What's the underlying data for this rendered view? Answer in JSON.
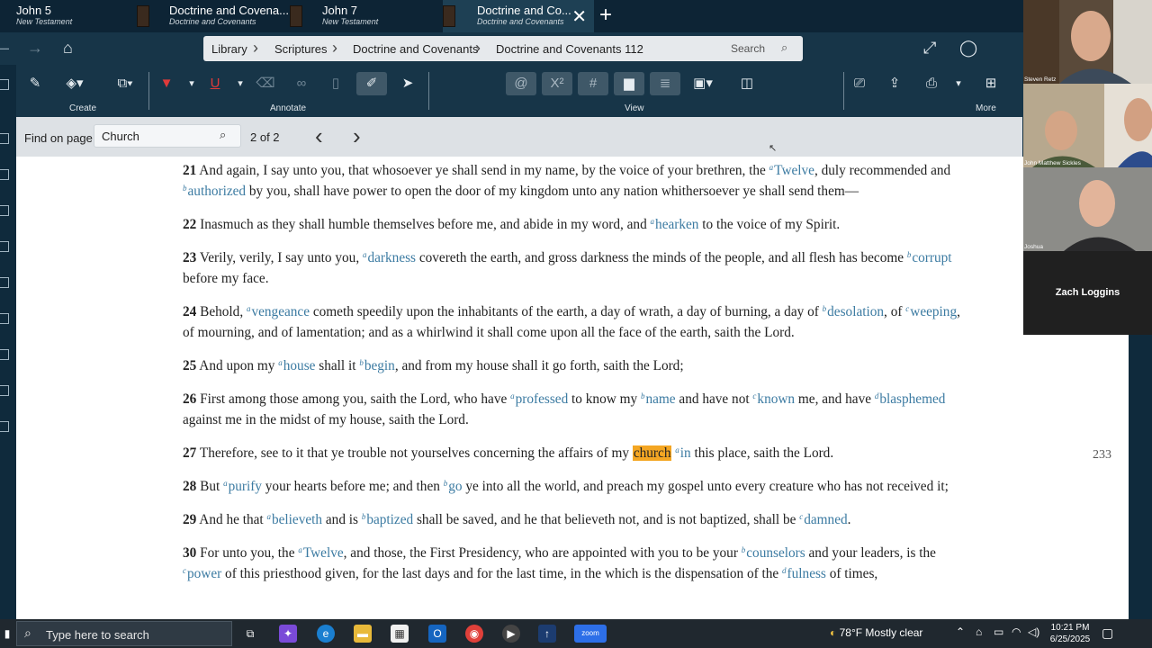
{
  "tabs": [
    {
      "title": "John 5",
      "subtitle": "New Testament"
    },
    {
      "title": "Doctrine and Covena...",
      "subtitle": "Doctrine and Covenants"
    },
    {
      "title": "John 7",
      "subtitle": "New Testament"
    },
    {
      "title": "Doctrine and Co...",
      "subtitle": "Doctrine and Covenants",
      "active": true
    }
  ],
  "breadcrumb": [
    "Library",
    "Scriptures",
    "Doctrine and Covenants",
    "Doctrine and Covenants 112"
  ],
  "search_placeholder": "Search",
  "ribbon": {
    "create": "Create",
    "annotate": "Annotate",
    "view": "View",
    "more": "More"
  },
  "find": {
    "label": "Find on page",
    "query": "Church",
    "count": "2 of 2"
  },
  "page_number": "233",
  "verses": [
    {
      "num": "21",
      "parts": [
        {
          "t": "And again, I say unto you, that whosoever ye shall send in my name, by the voice of your brethren, the "
        },
        {
          "fn": "a",
          "t": "Twelve"
        },
        {
          "t": ", duly recommended and "
        },
        {
          "fn": "b",
          "t": "authorized"
        },
        {
          "t": " by you, shall have power to open the door of my kingdom unto any nation whithersoever ye shall send them—"
        }
      ]
    },
    {
      "num": "22",
      "parts": [
        {
          "t": "Inasmuch as they shall humble themselves before me, and abide in my word, and "
        },
        {
          "fn": "a",
          "t": "hearken"
        },
        {
          "t": " to the voice of my Spirit."
        }
      ]
    },
    {
      "num": "23",
      "parts": [
        {
          "t": "Verily, verily, I say unto you, "
        },
        {
          "fn": "a",
          "t": "darkness"
        },
        {
          "t": " covereth the earth, and gross darkness the minds of the people, and all flesh has become "
        },
        {
          "fn": "b",
          "t": "corrupt"
        },
        {
          "t": " before my face."
        }
      ]
    },
    {
      "num": "24",
      "parts": [
        {
          "t": "Behold, "
        },
        {
          "fn": "a",
          "t": "vengeance"
        },
        {
          "t": " cometh speedily upon the inhabitants of the earth, a day of wrath, a day of burning, a day of "
        },
        {
          "fn": "b",
          "t": "desolation"
        },
        {
          "t": ", of "
        },
        {
          "fn": "c",
          "t": "weeping"
        },
        {
          "t": ", of mourning, and of lamentation; and as a whirlwind it shall come upon all the face of the earth, saith the Lord."
        }
      ]
    },
    {
      "num": "25",
      "parts": [
        {
          "t": "And upon my "
        },
        {
          "fn": "a",
          "t": "house"
        },
        {
          "t": " shall it "
        },
        {
          "fn": "b",
          "t": "begin"
        },
        {
          "t": ", and from my house shall it go forth, saith the Lord;"
        }
      ]
    },
    {
      "num": "26",
      "parts": [
        {
          "t": "First among those among you, saith the Lord, who have "
        },
        {
          "fn": "a",
          "t": "professed"
        },
        {
          "t": " to know my "
        },
        {
          "fn": "b",
          "t": "name"
        },
        {
          "t": " and have not "
        },
        {
          "fn": "c",
          "t": "known"
        },
        {
          "t": " me, and have "
        },
        {
          "fn": "d",
          "t": "blasphemed"
        },
        {
          "t": " against me in the midst of my house, saith the Lord."
        }
      ]
    },
    {
      "num": "27",
      "parts": [
        {
          "t": "Therefore, see to it that ye trouble not yourselves concerning the affairs of my "
        },
        {
          "hl": "church"
        },
        {
          "t": " "
        },
        {
          "fn": "a",
          "t": "in"
        },
        {
          "t": " this place, saith the Lord."
        }
      ]
    },
    {
      "num": "28",
      "parts": [
        {
          "t": "But "
        },
        {
          "fn": "a",
          "t": "purify"
        },
        {
          "t": " your hearts before me; and then "
        },
        {
          "fn": "b",
          "t": "go"
        },
        {
          "t": " ye into all the world, and preach my gospel unto every creature who has not received it;"
        }
      ]
    },
    {
      "num": "29",
      "parts": [
        {
          "t": "And he that "
        },
        {
          "fn": "a",
          "t": "believeth"
        },
        {
          "t": " and is "
        },
        {
          "fn": "b",
          "t": "baptized"
        },
        {
          "t": " shall be saved, and he that believeth not, and is not baptized, shall be "
        },
        {
          "fn": "c",
          "t": "damned"
        },
        {
          "t": "."
        }
      ]
    },
    {
      "num": "30",
      "parts": [
        {
          "t": "For unto you, the "
        },
        {
          "fn": "a",
          "t": "Twelve"
        },
        {
          "t": ", and those, the First Presidency, who are appointed with you to be your "
        },
        {
          "fn": "b",
          "t": "counselors"
        },
        {
          "t": " and your leaders, is the "
        },
        {
          "fn": "c",
          "t": "power"
        },
        {
          "t": " of this priesthood given, for the last days and for the last time, in the which is the dispensation of the "
        },
        {
          "fn": "d",
          "t": "fulness"
        },
        {
          "t": " of times,"
        }
      ]
    }
  ],
  "participants": [
    "Steven Retz",
    "John Matthew Sickles",
    "Joshua",
    "Zach Loggins"
  ],
  "taskbar": {
    "search_placeholder": "Type here to search",
    "weather": "78°F  Mostly clear",
    "time": "10:21 PM",
    "date": "6/25/2025"
  },
  "colors": {
    "accent_blue": "#3c7ba2",
    "highlight": "#f4a623",
    "chrome": "#173548"
  }
}
